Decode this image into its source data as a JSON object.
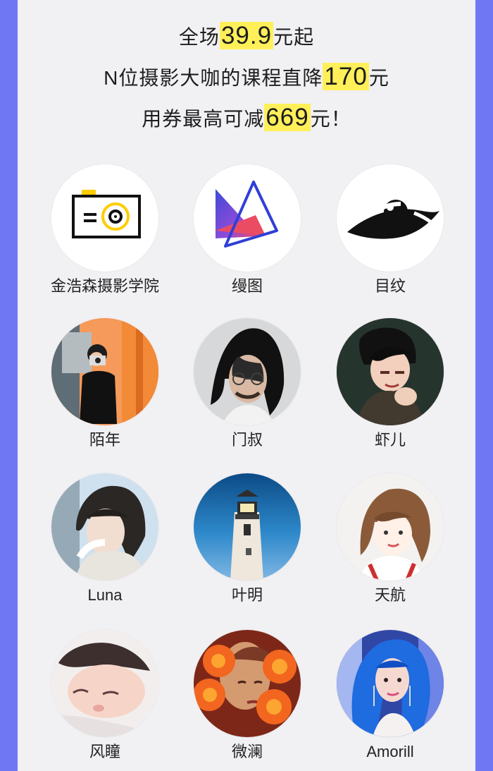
{
  "promo": {
    "line1_before": "全场",
    "line1_highlight": "39.9",
    "line1_after": "元起",
    "line2_before": "N位摄影大咖的课程直降",
    "line2_highlight": "170",
    "line2_after": "元",
    "line3_before": "用券最高可减",
    "line3_highlight": "669",
    "line3_after": "元！"
  },
  "items": [
    {
      "name": "金浩森摄影学院"
    },
    {
      "name": "缦图"
    },
    {
      "name": "目纹"
    },
    {
      "name": "陌年"
    },
    {
      "name": "门叔"
    },
    {
      "name": "虾儿"
    },
    {
      "name": "Luna"
    },
    {
      "name": "叶明"
    },
    {
      "name": "天航"
    },
    {
      "name": "风瞳"
    },
    {
      "name": "微澜"
    },
    {
      "name": "Amorill"
    }
  ]
}
